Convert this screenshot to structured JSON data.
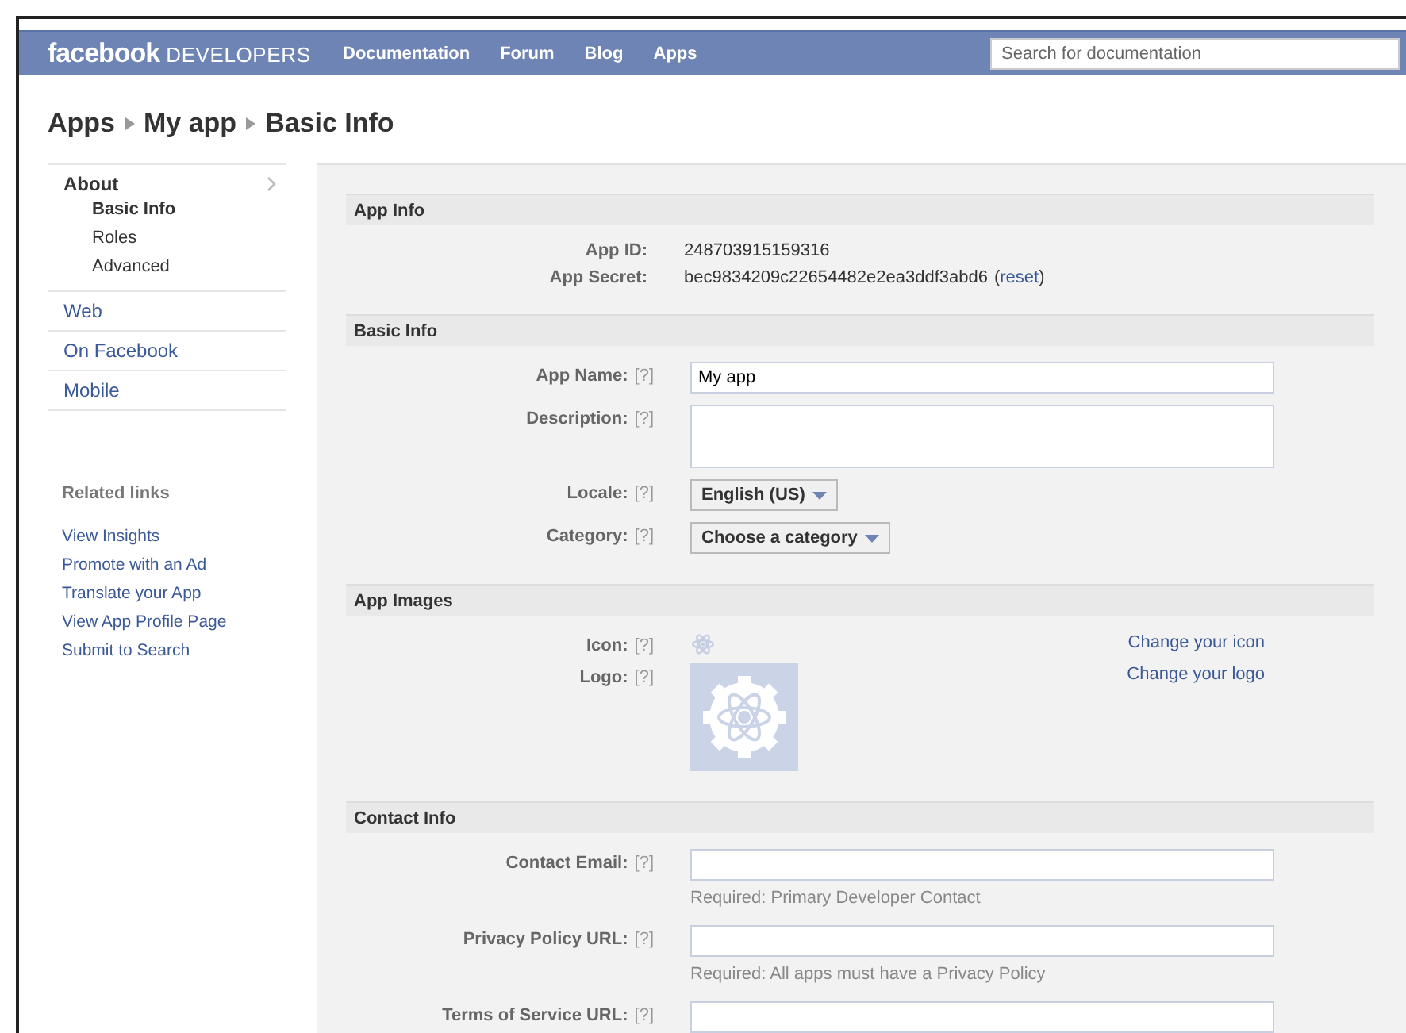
{
  "nav": {
    "brand": "facebook",
    "product": "DEVELOPERS",
    "links": [
      "Documentation",
      "Forum",
      "Blog",
      "Apps"
    ],
    "search": {
      "placeholder": "Search for documentation"
    }
  },
  "breadcrumb": [
    "Apps",
    "My app",
    "Basic Info"
  ],
  "sidebar": {
    "items": [
      {
        "label": "About",
        "expanded": true,
        "children": [
          {
            "label": "Basic Info",
            "selected": true
          },
          {
            "label": "Roles",
            "selected": false
          },
          {
            "label": "Advanced",
            "selected": false
          }
        ]
      },
      {
        "label": "Web",
        "expanded": false
      },
      {
        "label": "On Facebook",
        "expanded": false
      },
      {
        "label": "Mobile",
        "expanded": false
      }
    ],
    "related_title": "Related links",
    "related_links": [
      "View Insights",
      "Promote with an Ad",
      "Translate your App",
      "View App Profile Page",
      "Submit to Search"
    ]
  },
  "sections": [
    {
      "title": "App Info",
      "rows": [
        {
          "kind": "info",
          "label": "App ID:",
          "value": "248703915159316"
        },
        {
          "kind": "info",
          "label": "App Secret:",
          "value": "bec9834209c22654482e2ea3ddf3abd6",
          "link": {
            "open": "(",
            "text": "reset",
            "close": ")"
          }
        }
      ]
    },
    {
      "title": "Basic Info",
      "rows": [
        {
          "kind": "input",
          "label": "App Name:",
          "help": "[?]",
          "value": "My app"
        },
        {
          "kind": "textarea",
          "label": "Description:",
          "help": "[?]"
        },
        {
          "kind": "select",
          "label": "Locale:",
          "help": "[?]",
          "value": "English (US)"
        },
        {
          "kind": "select",
          "label": "Category:",
          "help": "[?]",
          "value": "Choose a category"
        }
      ]
    },
    {
      "title": "App Images",
      "rows": [
        {
          "kind": "icon",
          "label": "Icon:",
          "help": "[?]",
          "link": "Change your icon"
        },
        {
          "kind": "logo",
          "label": "Logo:",
          "help": "[?]",
          "link": "Change your logo"
        }
      ]
    },
    {
      "title": "Contact Info",
      "rows": [
        {
          "kind": "input",
          "label": "Contact Email:",
          "help": "[?]",
          "note": "Required: Primary Developer Contact"
        },
        {
          "kind": "input",
          "label": "Privacy Policy URL:",
          "help": "[?]",
          "note": "Required: All apps must have a Privacy Policy"
        },
        {
          "kind": "input",
          "label": "Terms of Service URL:",
          "help": "[?]"
        }
      ]
    }
  ]
}
